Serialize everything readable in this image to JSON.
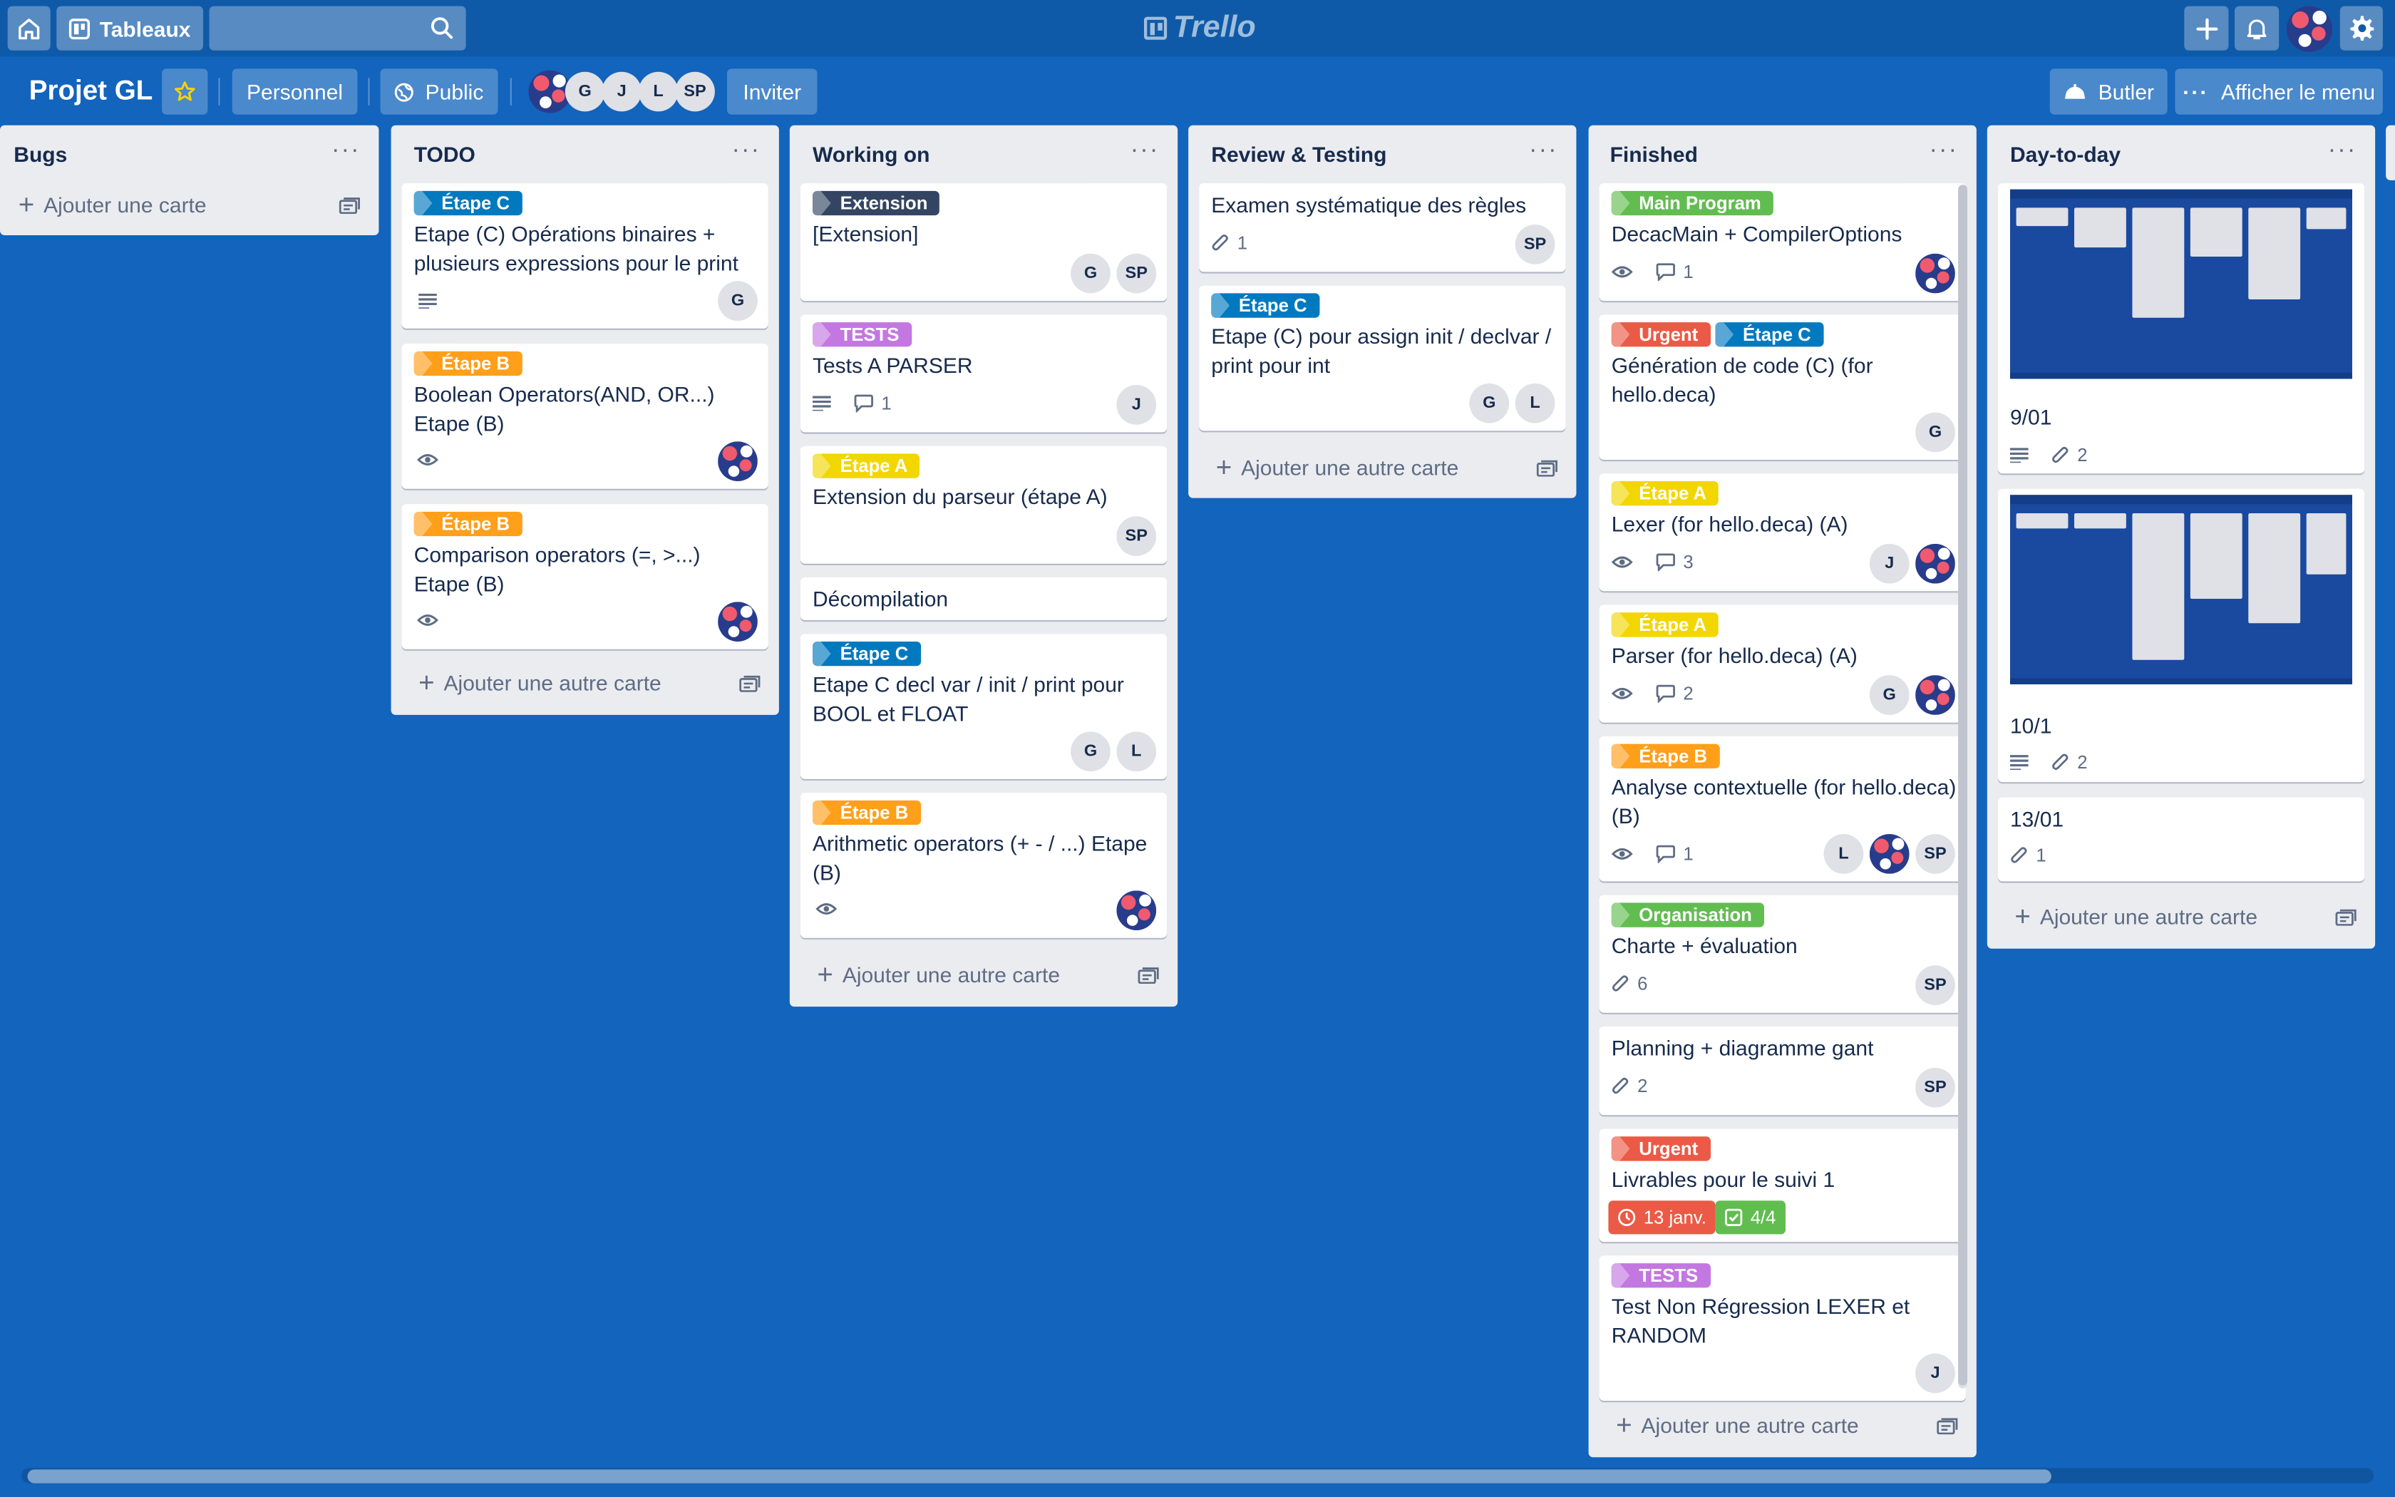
{
  "topbar": {
    "boards_label": "Tableaux",
    "search_placeholder": "",
    "logo_text": "Trello"
  },
  "board": {
    "title": "Projet GL",
    "visibility_personal": "Personnel",
    "visibility_public": "Public",
    "members": [
      "G",
      "J",
      "L",
      "SP"
    ],
    "invite_label": "Inviter",
    "butler_label": "Butler",
    "menu_label": "Afficher le menu"
  },
  "lists": {
    "bugs": {
      "title": "Bugs",
      "add_label": "Ajouter une carte"
    },
    "todo": {
      "title": "TODO",
      "add_label": "Ajouter une autre carte",
      "cards": [
        {
          "label": "Étape C",
          "title": "Etape (C) Opérations binaires + plusieurs expressions pour le print",
          "members": [
            "G"
          ]
        },
        {
          "label": "Étape B",
          "title": "Boolean Operators(AND, OR...) Etape (B)"
        },
        {
          "label": "Étape B",
          "title": "Comparison operators (=, >...) Etape (B)"
        }
      ]
    },
    "working": {
      "title": "Working on",
      "add_label": "Ajouter une autre carte",
      "cards": [
        {
          "label": "Extension",
          "title": "[Extension]",
          "members": [
            "G",
            "SP"
          ]
        },
        {
          "label": "TESTS",
          "title": "Tests A PARSER",
          "comments": "1",
          "members": [
            "J"
          ]
        },
        {
          "label": "Étape A",
          "title": "Extension du parseur (étape A)",
          "members": [
            "SP"
          ]
        },
        {
          "title": "Décompilation"
        },
        {
          "label": "Étape C",
          "title": "Etape C decl var / init / print pour BOOL et FLOAT",
          "members": [
            "G",
            "L"
          ]
        },
        {
          "label": "Étape B",
          "title": "Arithmetic operators (+ - / ...) Etape (B)"
        }
      ]
    },
    "review": {
      "title": "Review & Testing",
      "add_label": "Ajouter une autre carte",
      "cards": [
        {
          "title": "Examen systématique des règles",
          "attachments": "1",
          "members": [
            "SP"
          ]
        },
        {
          "label": "Étape C",
          "title": "Etape (C) pour assign init / declvar / print pour int",
          "members": [
            "G",
            "L"
          ]
        }
      ]
    },
    "finished": {
      "title": "Finished",
      "add_label": "Ajouter une autre carte",
      "cards": [
        {
          "label": "Main Program",
          "title": "DecacMain + CompilerOptions",
          "comments": "1"
        },
        {
          "labels": [
            "Urgent",
            "Étape C"
          ],
          "title": "Génération de code (C) (for hello.deca)",
          "members": [
            "G"
          ]
        },
        {
          "label": "Étape A",
          "title": "Lexer (for hello.deca) (A)",
          "comments": "3",
          "members": [
            "J"
          ]
        },
        {
          "label": "Étape A",
          "title": "Parser (for hello.deca) (A)",
          "comments": "2",
          "members": [
            "G"
          ]
        },
        {
          "label": "Étape B",
          "title": "Analyse contextuelle (for hello.deca) (B)",
          "comments": "1",
          "members": [
            "L",
            "SP"
          ]
        },
        {
          "label": "Organisation",
          "title": "Charte + évaluation",
          "attachments": "6",
          "members": [
            "SP"
          ]
        },
        {
          "title": "Planning + diagramme gant",
          "attachments": "2",
          "members": [
            "SP"
          ]
        },
        {
          "label": "Urgent",
          "title": "Livrables pour le suivi 1",
          "due": "13 janv.",
          "checklist": "4/4"
        },
        {
          "label": "TESTS",
          "title": "Test Non Régression LEXER et RANDOM",
          "members": [
            "J"
          ]
        }
      ]
    },
    "daytoday": {
      "title": "Day-to-day",
      "add_label": "Ajouter une autre carte",
      "cards": [
        {
          "title": "9/01",
          "attachments": "2"
        },
        {
          "title": "10/1",
          "attachments": "2"
        },
        {
          "title": "13/01",
          "attachments": "1"
        }
      ]
    }
  }
}
